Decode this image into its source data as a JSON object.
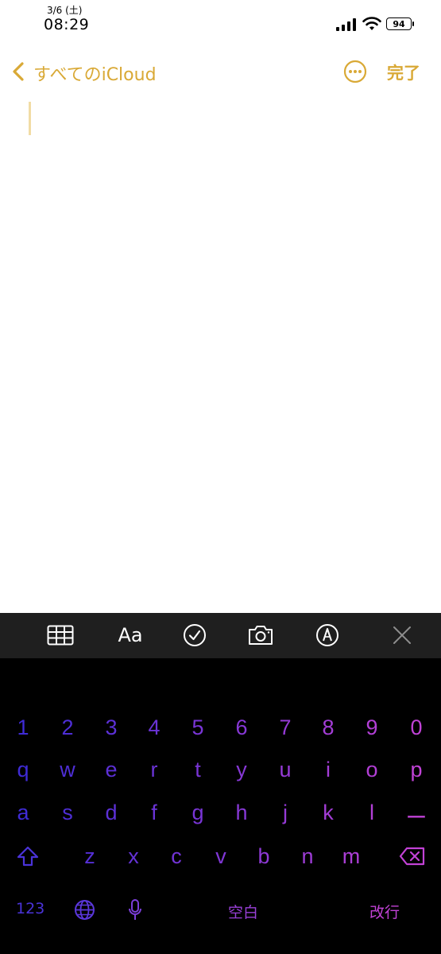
{
  "status_bar": {
    "date": "3/6 (土)",
    "time": "08:29",
    "battery_level": "94"
  },
  "nav": {
    "back_label": "すべてのiCloud",
    "done_label": "完了",
    "accent_color": "#d9a936"
  },
  "toolbar": {
    "icons": [
      "table-icon",
      "text-format-icon",
      "checklist-icon",
      "camera-icon",
      "markup-icon",
      "close-icon"
    ],
    "format_label": "Aa"
  },
  "keyboard": {
    "row_numbers": [
      "1",
      "2",
      "3",
      "4",
      "5",
      "6",
      "7",
      "8",
      "9",
      "0"
    ],
    "row_top": [
      "q",
      "w",
      "e",
      "r",
      "t",
      "y",
      "u",
      "i",
      "o",
      "p"
    ],
    "row_middle": [
      "a",
      "s",
      "d",
      "f",
      "g",
      "h",
      "j",
      "k",
      "l",
      "ー"
    ],
    "row_bottom": [
      "z",
      "x",
      "c",
      "v",
      "b",
      "n",
      "m"
    ],
    "numbers_label": "123",
    "space_label": "空白",
    "return_label": "改行",
    "gradient": [
      "#3d2bd6",
      "#c242d6"
    ]
  }
}
